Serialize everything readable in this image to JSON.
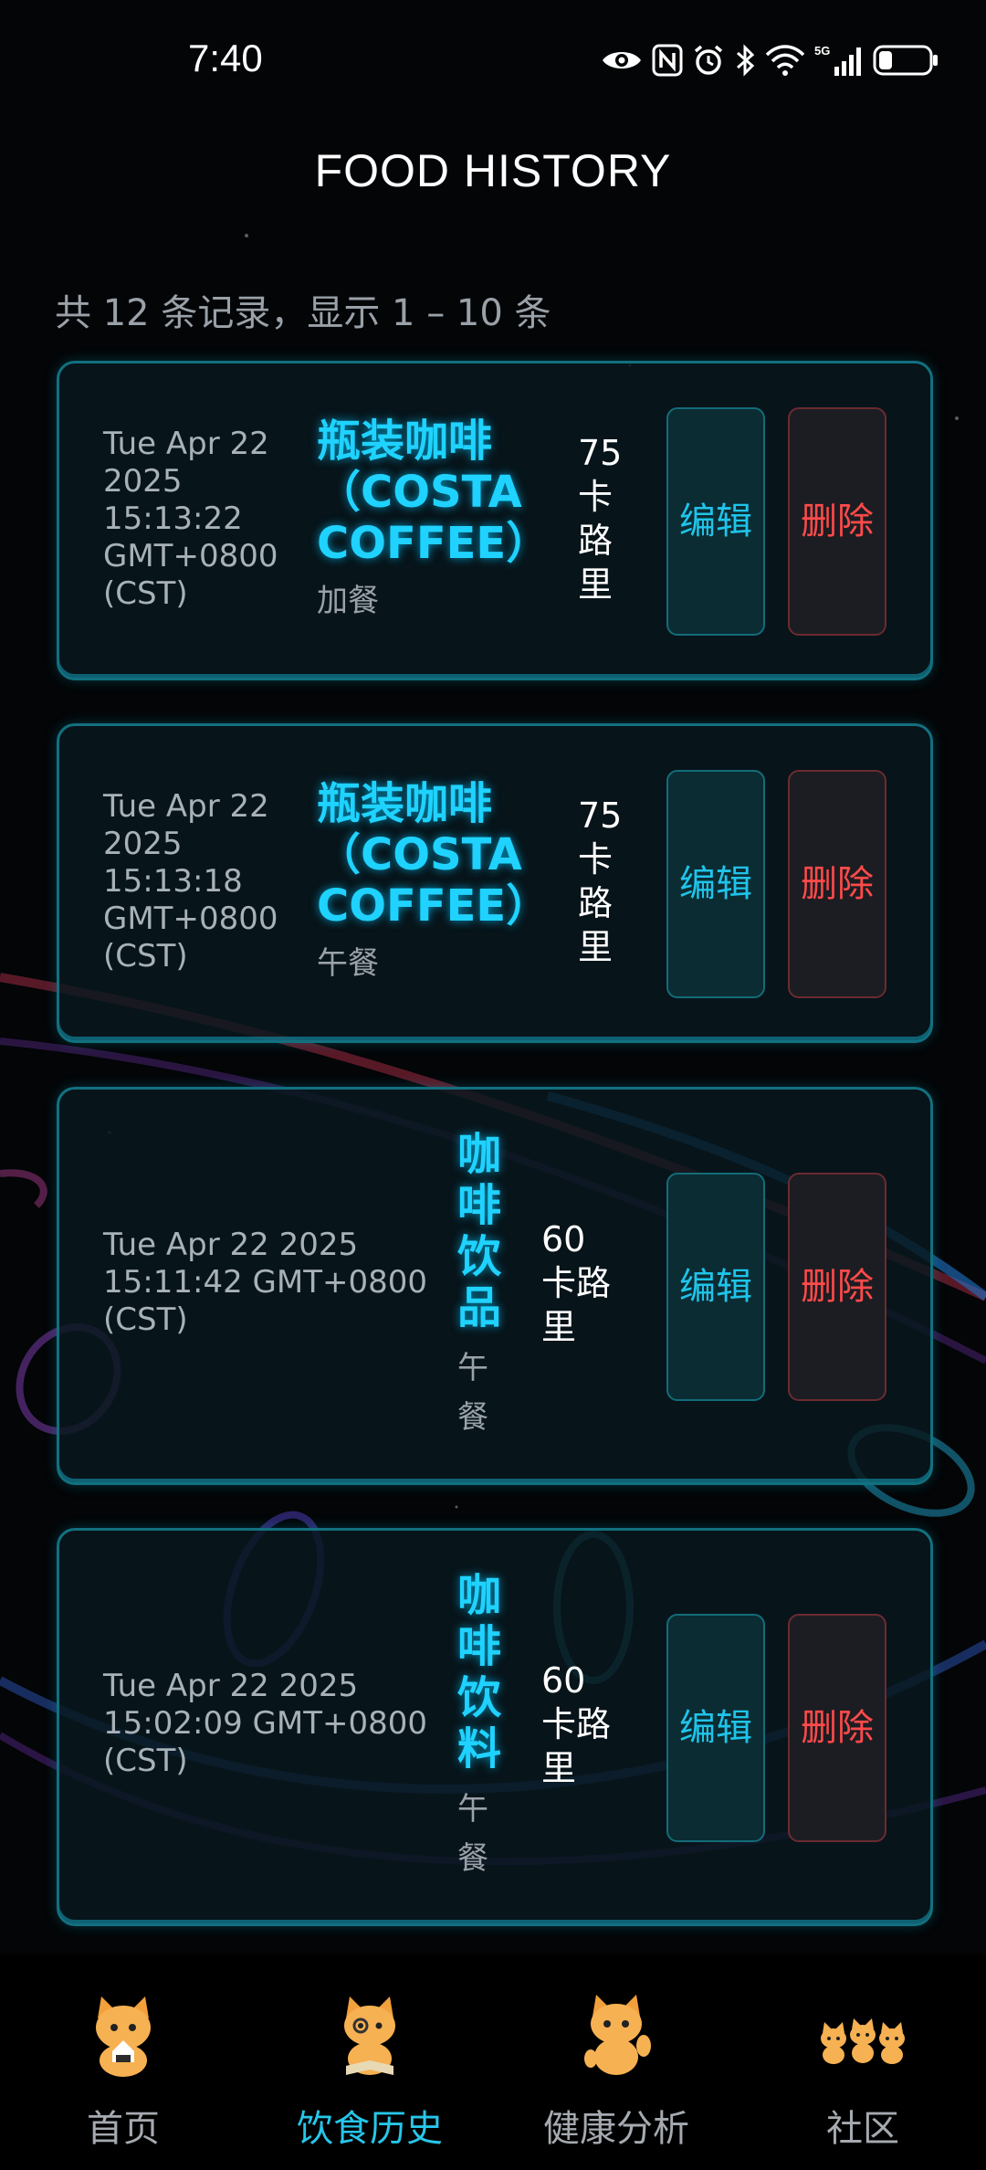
{
  "status_bar": {
    "time": "7:40",
    "icons": [
      "eye-icon",
      "nfc-icon",
      "alarm-icon",
      "bluetooth-icon",
      "wifi-icon",
      "signal-5g-icon",
      "battery-icon"
    ]
  },
  "header": {
    "title": "FOOD HISTORY",
    "summary": "共 12 条记录，显示 1 – 10 条"
  },
  "records": [
    {
      "date_lines": [
        "Tue Apr 22",
        "2025",
        "15:13:22",
        "GMT+0800",
        "(CST)"
      ],
      "name_lines": [
        "瓶装咖啡",
        "（COSTA",
        "COFFEE）"
      ],
      "meal_lines": [
        "加餐"
      ],
      "calorie_lines": [
        "75",
        "卡",
        "路",
        "里"
      ],
      "edit_label": "编辑",
      "delete_label": "删除"
    },
    {
      "date_lines": [
        "Tue Apr 22",
        "2025",
        "15:13:18",
        "GMT+0800",
        "(CST)"
      ],
      "name_lines": [
        "瓶装咖啡",
        "（COSTA",
        "COFFEE）"
      ],
      "meal_lines": [
        "午餐"
      ],
      "calorie_lines": [
        "75",
        "卡",
        "路",
        "里"
      ],
      "edit_label": "编辑",
      "delete_label": "删除"
    },
    {
      "date_lines": [
        "Tue Apr 22 2025",
        "15:11:42 GMT+0800",
        "(CST)"
      ],
      "name_lines": [
        "咖",
        "啡",
        "饮",
        "品"
      ],
      "meal_lines": [
        "午",
        "餐"
      ],
      "calorie_lines": [
        "60",
        "卡路",
        "里"
      ],
      "edit_label": "编辑",
      "delete_label": "删除"
    },
    {
      "date_lines": [
        "Tue Apr 22 2025",
        "15:02:09 GMT+0800",
        "(CST)"
      ],
      "name_lines": [
        "咖",
        "啡",
        "饮",
        "料"
      ],
      "meal_lines": [
        "午",
        "餐"
      ],
      "calorie_lines": [
        "60",
        "卡路",
        "里"
      ],
      "edit_label": "编辑",
      "delete_label": "删除"
    }
  ],
  "bottom_nav": {
    "items": [
      {
        "label": "首页",
        "icon": "cat-riceball-icon",
        "active": false
      },
      {
        "label": "饮食历史",
        "icon": "cat-book-icon",
        "active": true
      },
      {
        "label": "健康分析",
        "icon": "cat-waving-icon",
        "active": false
      },
      {
        "label": "社区",
        "icon": "cats-group-icon",
        "active": false
      }
    ]
  },
  "colors": {
    "accent": "#1fd2ff",
    "delete": "#ff4a4a",
    "card_border": "#12707f",
    "background": "#030507"
  }
}
